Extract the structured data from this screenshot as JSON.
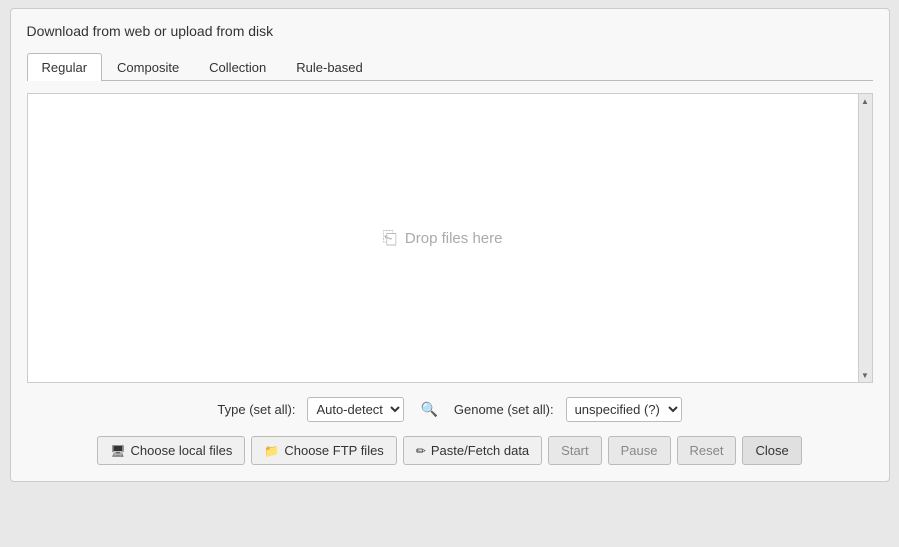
{
  "header": {
    "title": "Download from web or upload from disk"
  },
  "tabs": [
    {
      "id": "regular",
      "label": "Regular",
      "active": true
    },
    {
      "id": "composite",
      "label": "Composite",
      "active": false
    },
    {
      "id": "collection",
      "label": "Collection",
      "active": false
    },
    {
      "id": "rule-based",
      "label": "Rule-based",
      "active": false
    }
  ],
  "dropzone": {
    "text": "Drop files here",
    "icon": "📋"
  },
  "type_control": {
    "label": "Type (set all):",
    "value": "Auto-detect",
    "options": [
      "Auto-detect"
    ]
  },
  "genome_control": {
    "label": "Genome (set all):",
    "value": "unspecified (?)",
    "options": [
      "unspecified (?)"
    ]
  },
  "buttons": {
    "choose_local": "Choose local files",
    "choose_ftp": "Choose FTP files",
    "paste_fetch": "Paste/Fetch data",
    "start": "Start",
    "pause": "Pause",
    "reset": "Reset",
    "close": "Close"
  }
}
